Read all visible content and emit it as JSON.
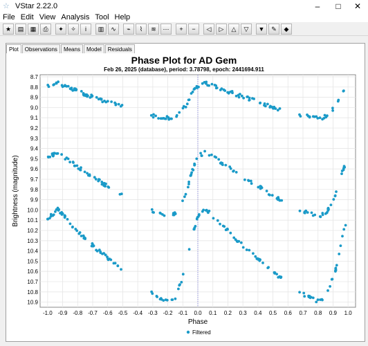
{
  "window": {
    "title": "VStar 2.22.0",
    "icon": "star-icon",
    "controls": [
      "–",
      "□",
      "✕"
    ]
  },
  "menu": [
    "File",
    "Edit",
    "View",
    "Analysis",
    "Tool",
    "Help"
  ],
  "toolbar": {
    "groups": [
      [
        {
          "icon": "new-star-icon"
        },
        {
          "icon": "open-file-icon"
        },
        {
          "icon": "save-icon"
        },
        {
          "icon": "print-icon"
        }
      ],
      [
        {
          "icon": "aavso-star-icon"
        },
        {
          "icon": "star-search-icon"
        },
        {
          "icon": "info-icon"
        }
      ],
      [
        {
          "icon": "raw-plot-icon"
        },
        {
          "icon": "phase-plot-icon"
        }
      ],
      [
        {
          "icon": "period-search-icon"
        },
        {
          "icon": "fit-icon"
        },
        {
          "icon": "model-icon"
        },
        {
          "icon": "residuals-icon"
        }
      ],
      [
        {
          "icon": "zoom-in-icon"
        },
        {
          "icon": "zoom-out-icon"
        }
      ],
      [
        {
          "icon": "pan-left-icon"
        },
        {
          "icon": "pan-right-icon"
        },
        {
          "icon": "pan-up-icon"
        },
        {
          "icon": "pan-down-icon"
        }
      ],
      [
        {
          "icon": "filter-icon"
        },
        {
          "icon": "obs-details-icon"
        },
        {
          "icon": "plugin-icon"
        }
      ]
    ]
  },
  "tabs": [
    "Plot",
    "Observations",
    "Means",
    "Model",
    "Residuals"
  ],
  "active_tab": "Plot",
  "colors": {
    "series": "#1a9ac8",
    "marker_line": "#7b7bd8"
  },
  "chart_data": {
    "type": "scatter",
    "title": "Phase Plot for AD Gem",
    "subtitle": "Feb 26, 2025 (database), period: 3.78798, epoch: 2441694.911",
    "xlabel": "Phase",
    "ylabel": "Brightness (magnitude)",
    "xlim": [
      -1.05,
      1.05
    ],
    "ylim": [
      10.95,
      8.68
    ],
    "y_inverted": true,
    "x_ticks": [
      "-1.0",
      "-0.9",
      "-0.8",
      "-0.7",
      "-0.6",
      "-0.5",
      "-0.4",
      "-0.3",
      "-0.2",
      "-0.1",
      "0.0",
      "0.1",
      "0.2",
      "0.3",
      "0.4",
      "0.5",
      "0.6",
      "0.7",
      "0.8",
      "0.9",
      "1.0"
    ],
    "y_ticks": [
      "8.7",
      "8.8",
      "8.9",
      "9.0",
      "9.1",
      "9.2",
      "9.3",
      "9.4",
      "9.5",
      "9.6",
      "9.7",
      "9.8",
      "9.9",
      "10.0",
      "10.1",
      "10.2",
      "10.3",
      "10.4",
      "10.5",
      "10.6",
      "10.7",
      "10.8",
      "10.9"
    ],
    "grid": true,
    "legend": {
      "position": "bottom",
      "entries": [
        "Filtered"
      ]
    },
    "marker_x": 0.0,
    "series": [
      {
        "name": "Filtered",
        "bands": [
          {
            "min": 8.76,
            "max": 9.12
          },
          {
            "min": 9.43,
            "max": 10.09
          },
          {
            "min": 9.99,
            "max": 10.93
          }
        ],
        "curve": [
          [
            -1.0,
            0.1
          ],
          [
            -0.93,
            0.0
          ],
          [
            -0.85,
            0.15
          ],
          [
            -0.7,
            0.38
          ],
          [
            -0.55,
            0.58
          ],
          [
            -0.42,
            0.76
          ],
          [
            -0.33,
            0.86
          ],
          [
            -0.2,
            0.96
          ],
          [
            -0.15,
            0.92
          ],
          [
            -0.08,
            0.62
          ],
          [
            -0.04,
            0.3
          ],
          [
            0.0,
            0.08
          ],
          [
            0.05,
            0.0
          ],
          [
            0.15,
            0.15
          ],
          [
            0.3,
            0.38
          ],
          [
            0.45,
            0.58
          ],
          [
            0.56,
            0.73
          ],
          [
            0.67,
            0.86
          ],
          [
            0.8,
            0.96
          ],
          [
            0.85,
            0.92
          ],
          [
            0.92,
            0.62
          ],
          [
            0.96,
            0.3
          ],
          [
            1.0,
            0.08
          ]
        ],
        "gaps": [
          [
            -0.5,
            -0.31
          ],
          [
            0.56,
            0.67
          ]
        ]
      }
    ]
  }
}
